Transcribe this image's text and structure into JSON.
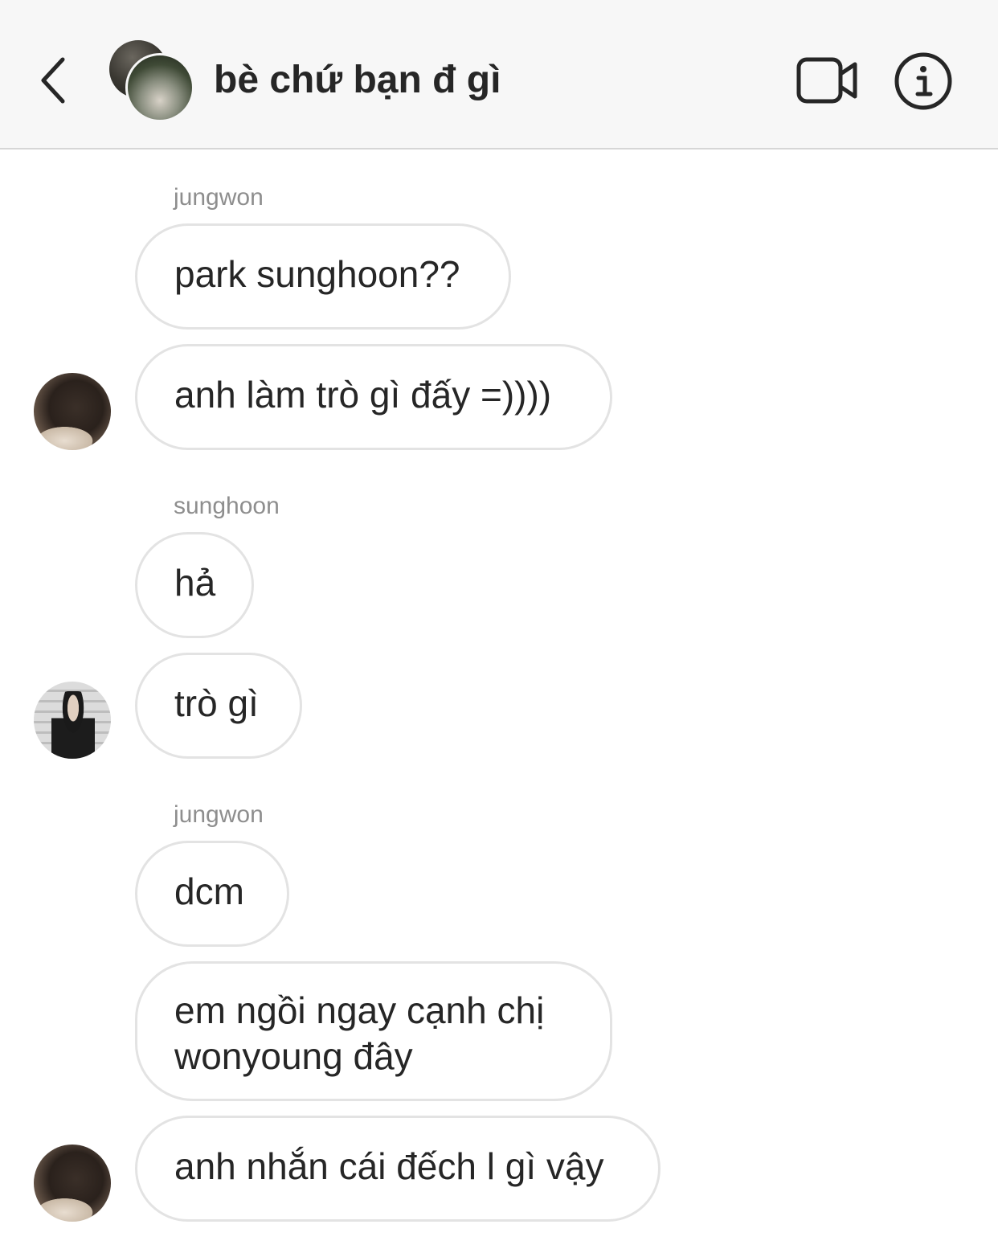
{
  "header": {
    "title": "bè chứ bạn đ gì",
    "back_icon": "chevron-left-icon",
    "video_icon": "video-camera-icon",
    "info_icon": "info-icon"
  },
  "messages": [
    {
      "sender": "jungwon",
      "bubbles": [
        "park sunghoon??",
        "anh làm trò gì đấy =))))"
      ]
    },
    {
      "sender": "sunghoon",
      "bubbles": [
        "hả",
        "trò gì"
      ]
    },
    {
      "sender": "jungwon",
      "bubbles": [
        "dcm",
        "em ngồi ngay cạnh chị wonyoung đây",
        "anh nhắn cái đếch l gì vậy"
      ]
    }
  ]
}
